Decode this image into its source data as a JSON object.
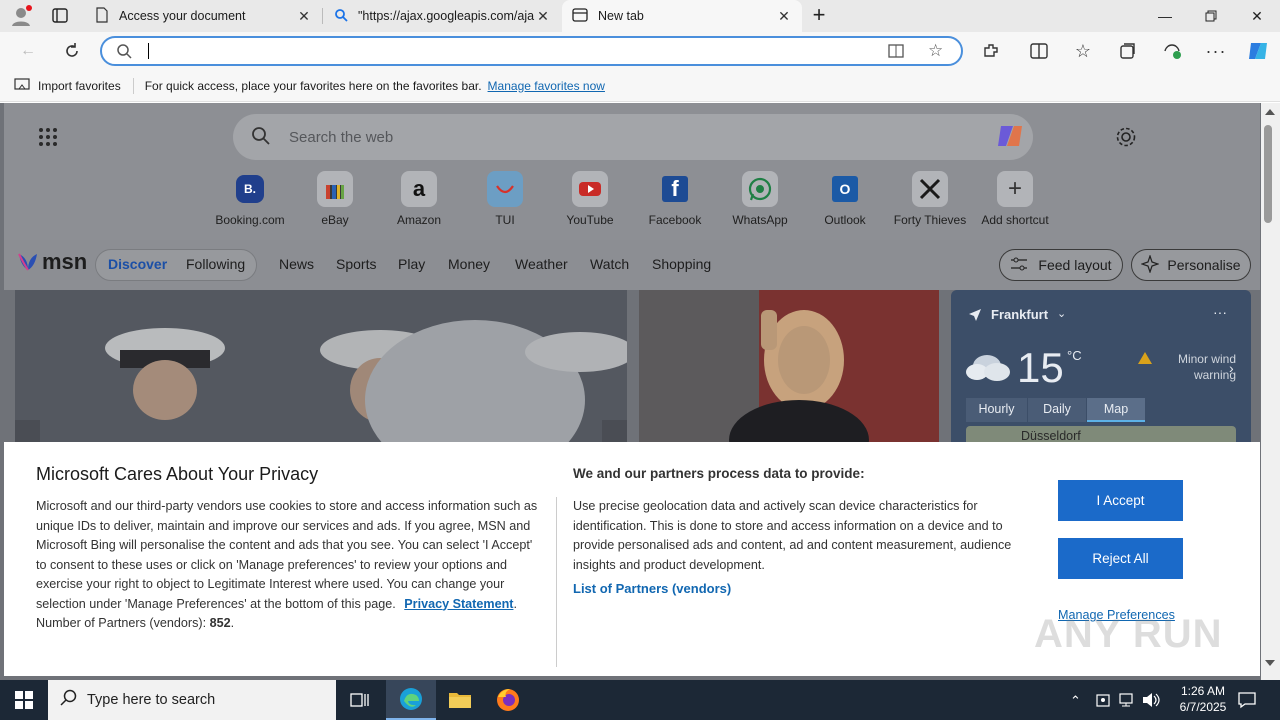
{
  "tabs": [
    {
      "label": "Access your document"
    },
    {
      "label": "\"https://ajax.googleapis.com/aja"
    },
    {
      "label": "New tab"
    }
  ],
  "address": {
    "value": ""
  },
  "favorites_bar": {
    "import_label": "Import favorites",
    "message": "For quick access, place your favorites here on the favorites bar.",
    "manage_link": "Manage favorites now"
  },
  "newtab": {
    "search_placeholder": "Search the web",
    "shortcuts": [
      {
        "label": "Booking.com",
        "glyph": "B."
      },
      {
        "label": "eBay",
        "glyph": ""
      },
      {
        "label": "Amazon",
        "glyph": "a"
      },
      {
        "label": "TUI",
        "glyph": ""
      },
      {
        "label": "YouTube",
        "glyph": ""
      },
      {
        "label": "Facebook",
        "glyph": "f"
      },
      {
        "label": "WhatsApp",
        "glyph": ""
      },
      {
        "label": "Outlook",
        "glyph": "O"
      },
      {
        "label": "Forty Thieves",
        "glyph": ""
      },
      {
        "label": "Add shortcut",
        "glyph": "+"
      }
    ],
    "brand": "msn",
    "nav": {
      "discover": "Discover",
      "following": "Following",
      "items": [
        "News",
        "Sports",
        "Play",
        "Money",
        "Weather",
        "Watch",
        "Shopping"
      ],
      "feed_layout": "Feed layout",
      "personalise": "Personalise"
    },
    "weather": {
      "location": "Frankfurt",
      "temperature": "15",
      "unit": "°C",
      "alert": "Minor wind warning",
      "tabs": [
        "Hourly",
        "Daily",
        "Map"
      ],
      "selected_tab": "Map",
      "map_label": "Düsseldorf"
    }
  },
  "privacy": {
    "title": "Microsoft Cares About Your Privacy",
    "body": "Microsoft and our third-party vendors use cookies to store and access information such as unique IDs to deliver, maintain and improve our services and ads. If you agree, MSN and Microsoft Bing will personalise the content and ads that you see. You can select 'I Accept' to consent to these uses or click on 'Manage preferences' to review your options and exercise your right to object to Legitimate Interest where used.  You can change your selection under 'Manage Preferences' at the bottom of this page.",
    "privacy_link": "Privacy Statement",
    "partners_label": "Number of Partners (vendors):",
    "partners_count": "852",
    "purposes_title": "We and our partners process data to provide:",
    "purposes_body": "Use precise geolocation data and actively scan device characteristics for identification. This is done to store and access information on a device and to provide personalised ads and content, ad and content measurement, audience insights and product development.",
    "partners_link": "List of Partners (vendors)",
    "accept": "I Accept",
    "reject": "Reject All",
    "manage": "Manage Preferences"
  },
  "taskbar": {
    "search_placeholder": "Type here to search",
    "time": "1:26 AM",
    "date": "6/7/2025"
  },
  "watermark": "ANY RUN",
  "colors": {
    "accent": "#1b6ac9",
    "link": "#1167b1",
    "taskbar": "#1c2836"
  }
}
